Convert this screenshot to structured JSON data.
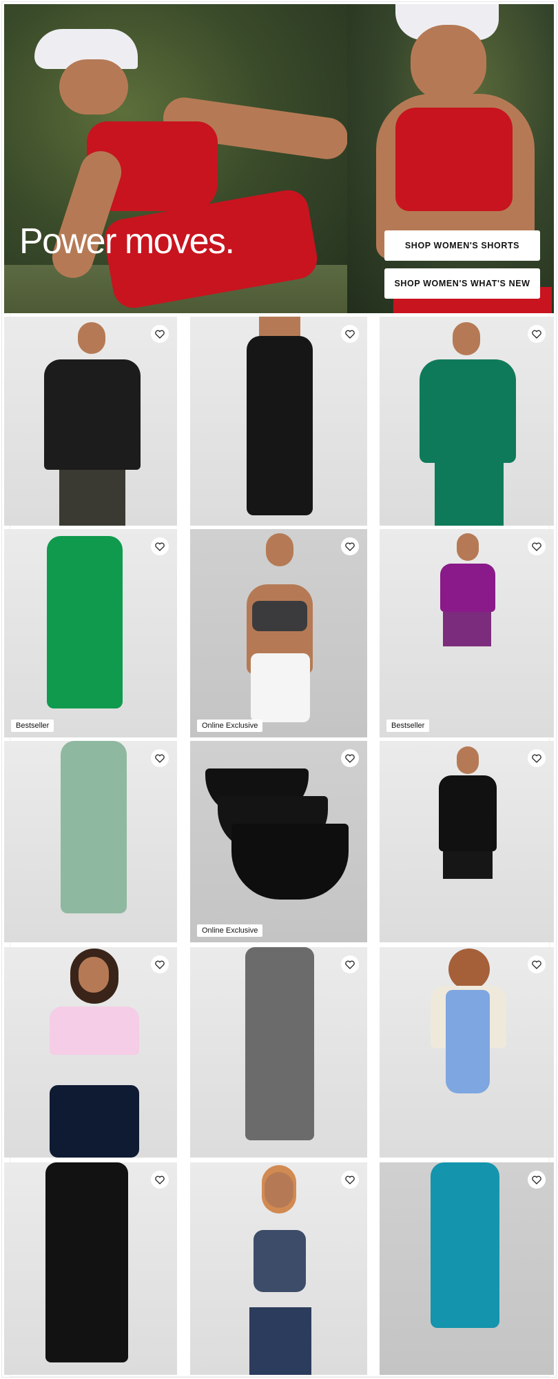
{
  "hero": {
    "headline": "Power moves.",
    "buttons": [
      {
        "label": "SHOP WOMEN'S SHORTS"
      },
      {
        "label": "SHOP WOMEN'S WHAT'S NEW"
      }
    ]
  },
  "grid": {
    "favorite_icon": "heart-outline-icon",
    "products": [
      {
        "id": "p1",
        "badge": ""
      },
      {
        "id": "p2",
        "badge": ""
      },
      {
        "id": "p3",
        "badge": ""
      },
      {
        "id": "p4",
        "badge": "Bestseller"
      },
      {
        "id": "p5",
        "badge": "Online Exclusive"
      },
      {
        "id": "p6",
        "badge": "Bestseller"
      },
      {
        "id": "p7",
        "badge": ""
      },
      {
        "id": "p8",
        "badge": "Online Exclusive"
      },
      {
        "id": "p9",
        "badge": ""
      },
      {
        "id": "p10",
        "badge": ""
      },
      {
        "id": "p11",
        "badge": ""
      },
      {
        "id": "p12",
        "badge": ""
      },
      {
        "id": "p13",
        "badge": ""
      },
      {
        "id": "p14",
        "badge": ""
      },
      {
        "id": "p15",
        "badge": ""
      }
    ]
  },
  "colors": {
    "hero_red": "#c8141f",
    "badge_bg": "#ffffff",
    "text": "#111111"
  }
}
